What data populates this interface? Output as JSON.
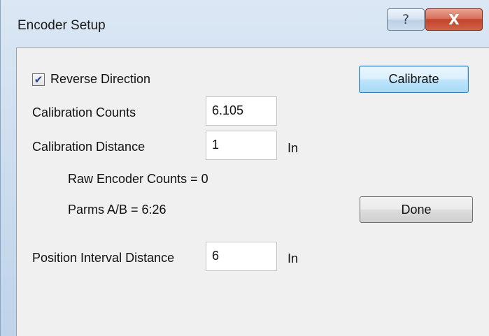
{
  "window": {
    "title": "Encoder Setup",
    "help_glyph": "?",
    "close_glyph": "X"
  },
  "form": {
    "reverse_direction": {
      "label": "Reverse Direction",
      "checked": true
    },
    "calibration_counts": {
      "label": "Calibration Counts",
      "value": "6.105"
    },
    "calibration_distance": {
      "label": "Calibration Distance",
      "value": "1",
      "unit": "In"
    },
    "raw_encoder_counts": "Raw Encoder Counts = 0",
    "parms": "Parms A/B = 6:26",
    "position_interval_distance": {
      "label": "Position Interval Distance",
      "value": "6",
      "unit": "In"
    }
  },
  "buttons": {
    "calibrate": "Calibrate",
    "done": "Done"
  },
  "icons": {
    "help": "help-icon",
    "close": "close-icon",
    "check": "checkmark-icon"
  },
  "colors": {
    "title_gradient_top": "#dbe7f4",
    "client_bg": "#f0f0f0",
    "close_red": "#c2432a",
    "default_button_border": "#3c7fb1"
  }
}
